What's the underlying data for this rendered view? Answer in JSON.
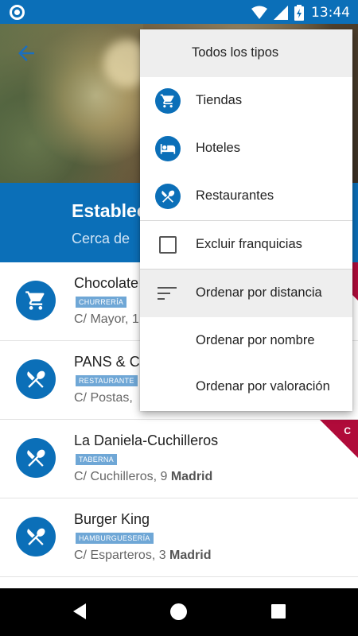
{
  "status_bar": {
    "time": "13:44"
  },
  "header": {
    "title": "Establec",
    "subtitle": "Cerca de "
  },
  "list": [
    {
      "name": "Chocolate",
      "tag": "CHURRERÍA",
      "address_street": "C/ Mayor, 1",
      "address_city": "",
      "icon": "cart-icon",
      "ribbon": ""
    },
    {
      "name": "PANS & C",
      "tag": "RESTAURANTE",
      "address_street": "C/ Postas, ",
      "address_city": "",
      "icon": "fork-knife-icon",
      "ribbon": ""
    },
    {
      "name": "La Daniela-Cuchilleros",
      "tag": "TABERNA",
      "address_street": "C/ Cuchilleros, 9 ",
      "address_city": "Madrid",
      "icon": "fork-knife-icon",
      "ribbon": "C"
    },
    {
      "name": "Burger King",
      "tag": "HAMBURGUESERÍA",
      "address_street": "C/ Esparteros, 3 ",
      "address_city": "Madrid",
      "icon": "fork-knife-icon",
      "ribbon": ""
    }
  ],
  "menu": {
    "header": "Todos los tipos",
    "types": [
      {
        "label": "Tiendas",
        "icon": "cart-icon"
      },
      {
        "label": "Hoteles",
        "icon": "bed-icon"
      },
      {
        "label": "Restaurantes",
        "icon": "fork-knife-icon"
      }
    ],
    "exclude_franchises": "Excluir franquicias",
    "exclude_franchises_checked": false,
    "sort": [
      {
        "label": "Ordenar por distancia",
        "selected": true
      },
      {
        "label": "Ordenar por nombre",
        "selected": false
      },
      {
        "label": "Ordenar por valoración",
        "selected": false
      }
    ]
  },
  "colors": {
    "primary": "#0b6fb8",
    "ribbon": "#b00b3a",
    "tag": "#6fa7d6"
  }
}
